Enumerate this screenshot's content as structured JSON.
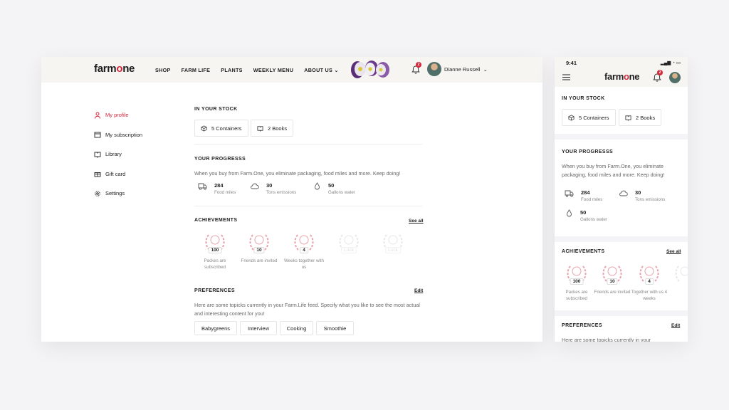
{
  "brand": {
    "logo_text": "farm",
    "logo_dot": "o",
    "logo_tail": "ne",
    "accent": "#d4263b"
  },
  "nav": {
    "items": [
      "SHOP",
      "FARM LIFE",
      "PLANTS",
      "WEEKLY MENU",
      "ABOUT US"
    ]
  },
  "header": {
    "notifications": "2",
    "user_name": "Dianne Russell"
  },
  "sidebar": {
    "items": [
      {
        "label": "My profile",
        "icon": "user-icon"
      },
      {
        "label": "My subscription",
        "icon": "calendar-icon"
      },
      {
        "label": "Library",
        "icon": "book-icon"
      },
      {
        "label": "Gift card",
        "icon": "gift-icon"
      },
      {
        "label": "Settings",
        "icon": "gear-icon"
      }
    ]
  },
  "stock": {
    "title": "IN YOUR STOCK",
    "containers": "5 Containers",
    "books": "2 Books"
  },
  "progress": {
    "title": "YOUR PROGRESSS",
    "text": "When you buy from Farm.One, you eliminate packaging, food miles and more. Keep doing!",
    "stats": [
      {
        "value": "284",
        "label": "Food miles",
        "icon": "truck-icon"
      },
      {
        "value": "30",
        "label": "Tons emissions",
        "icon": "cloud-icon"
      },
      {
        "value": "50",
        "label": "Gallons water",
        "icon": "drop-icon"
      }
    ]
  },
  "achievements": {
    "title": "ACHIEVEMENTS",
    "see_all": "See all",
    "items": [
      {
        "count": "100",
        "caption": "Packes are subscribed"
      },
      {
        "count": "10",
        "caption": "Friends are invited"
      },
      {
        "count": "4",
        "caption": "Weeks together with us"
      },
      {
        "count": "Lock",
        "caption": ""
      },
      {
        "count": "Lock",
        "caption": ""
      }
    ]
  },
  "preferences": {
    "title": "PREFERENCES",
    "edit": "Edit",
    "text": "Here are some topicks currently in your Farm.Life feed. Specify what you like to see the most actual and interesting content for you!",
    "tags": [
      "Babygreens",
      "Interview",
      "Cooking",
      "Smoothie"
    ]
  },
  "mobile": {
    "time": "9:41",
    "notifications": "2",
    "progress_text": "When you buy from Farm.One, you eliminate packaging, food miles and more. Keep doing!",
    "ach_captions": [
      "Packes are subscribed",
      "Friends are invited",
      "Together with us 4 weeks"
    ],
    "pref_text": "Here are some topicks currently in your"
  }
}
